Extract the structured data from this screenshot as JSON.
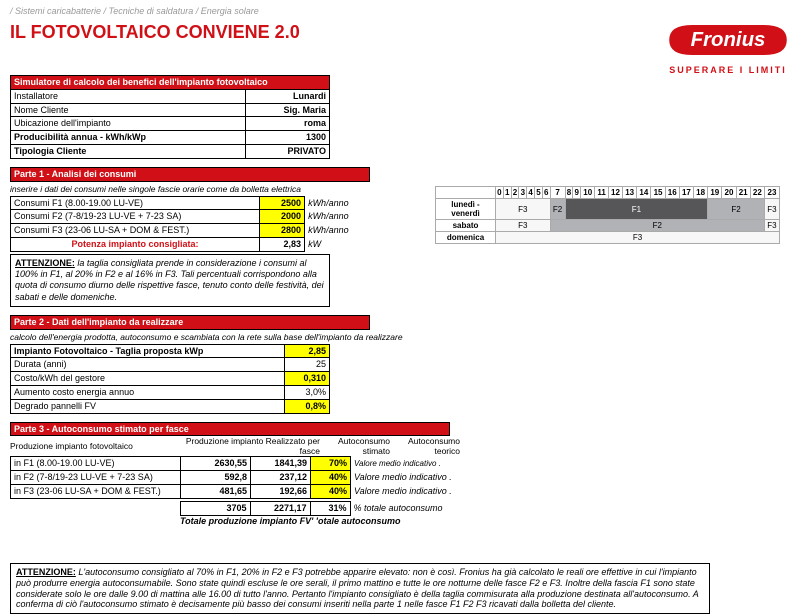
{
  "breadcrumb": "/ Sistemi caricabatterie / Tecniche di saldatura / Energia solare",
  "title": "IL FOTOVOLTAICO CONVIENE 2.0",
  "tagline": "SUPERARE I LIMITI",
  "sim": {
    "header": "Simulatore di calcolo dei benefici dell'impianto fotovoltaico",
    "rows": {
      "installatore_l": "Installatore",
      "installatore_v": "Lunardi",
      "nome_l": "Nome Cliente",
      "nome_v": "Sig. Maria",
      "ubic_l": "Ubicazione dell'impianto",
      "ubic_v": "roma",
      "prod_l": "Producibilità annua - kWh/kWp",
      "prod_v": "1300",
      "tip_l": "Tipologia Cliente",
      "tip_v": "PRIVATO"
    }
  },
  "p1": {
    "header": "Parte 1 - Analisi dei consumi",
    "note": "inserire i dati dei consumi nelle singole fascie orarie come da bolletta elettrica",
    "r1l": "Consumi F1 (8.00-19.00 LU-VE)",
    "r1v": "2500",
    "u": "kWh/anno",
    "r2l": "Consumi F2 (7-8/19-23 LU-VE + 7-23 SA)",
    "r2v": "2000",
    "r3l": "Consumi F3 (23-06 LU-SA + DOM & FEST.)",
    "r3v": "2800",
    "potl": "Potenza impianto consigliata:",
    "potv": "2,83",
    "potu": "kW",
    "warn": "la taglia consigliata prende in considerazione i consumi al 100% in F1, al 20% in F2 e al 16% in F3. Tali percentuali corrispondono alla quota di consumo diurno delle rispettive fasce, tenuto conto delle festività, dei sabati e delle domeniche.",
    "att": "ATTENZIONE:"
  },
  "p2": {
    "header": "Parte 2 - Dati dell'impianto da realizzare",
    "note": "calcolo dell'energia prodotta, autoconsumo e scambiata con la rete sulla base dell'impianto da realizzare",
    "r1l": "Impianto Fotovoltaico - Taglia proposta kWp",
    "r1v": "2,85",
    "r2l": "Durata (anni)",
    "r2v": "25",
    "r3l": "Costo/kWh del gestore",
    "r3v": "0,310",
    "r4l": "Aumento costo energia annuo",
    "r4v": "3,0%",
    "r5l": "Degrado pannelli FV",
    "r5v": "0,8%"
  },
  "p3": {
    "header": "Parte 3 - Autoconsumo stimato per fasce",
    "col1": "Produzione impianto fotovoltaico",
    "col2": "Produzione impianto Realizzato per fasce",
    "col3": "Autoconsumo stimato",
    "col4": "Autoconsumo teorico",
    "r1l": "in F1 (8.00-19.00 LU-VE)",
    "r1a": "2630,55",
    "r1b": "1841,39",
    "r1c": "70%",
    "vm": "Valore medio indicativo .",
    "r2l": "in F2 (7-8/19-23 LU-VE + 7-23 SA)",
    "r2a": "592,8",
    "r2b": "237,12",
    "r2c": "40%",
    "r3l": "in F3 (23-06 LU-SA + DOM & FEST.)",
    "r3a": "481,65",
    "r3b": "192,66",
    "r3c": "40%",
    "tota": "3705",
    "totb": "2271,17",
    "totc": "31%",
    "totn": "% totale autoconsumo",
    "totlbl": "Totale produzione impianto FV' 'otale autoconsumo"
  },
  "warnfull": "L'autoconsumo consigliato al 70% in F1, 20% in F2 e F3 potrebbe apparire elevato: non è così. Fronius ha già calcolato le reali ore effettive in cui l'impianto può produrre energia autoconsumabile. Sono state quindi escluse le ore serali, il primo mattino e tutte le ore notturne delle fasce F2 e F3. Inoltre della fascia F1 sono state considerate solo le ore dalle 9.00 di mattina alle 16.00 di tutto l'anno. Pertanto l'impianto consigliato è della taglia commisurata alla produzione destinata all'autoconsumo. A conferma di ciò l'autoconsumo stimato è decisamente più basso dei consumi inseriti nella parte 1 nelle fasce F1 F2 F3 ricavati dalla bolletta del cliente.",
  "att2": "ATTENZIONE:",
  "time": {
    "hours": [
      "0",
      "1",
      "2",
      "3",
      "4",
      "5",
      "6",
      "7",
      "8",
      "9",
      "10",
      "11",
      "12",
      "13",
      "14",
      "15",
      "16",
      "17",
      "18",
      "19",
      "20",
      "21",
      "22",
      "23"
    ],
    "row1": "lunedì - venerdì",
    "row2": "sabato",
    "row3": "domenica",
    "f1": "F1",
    "f2": "F2",
    "f3": "F3"
  }
}
